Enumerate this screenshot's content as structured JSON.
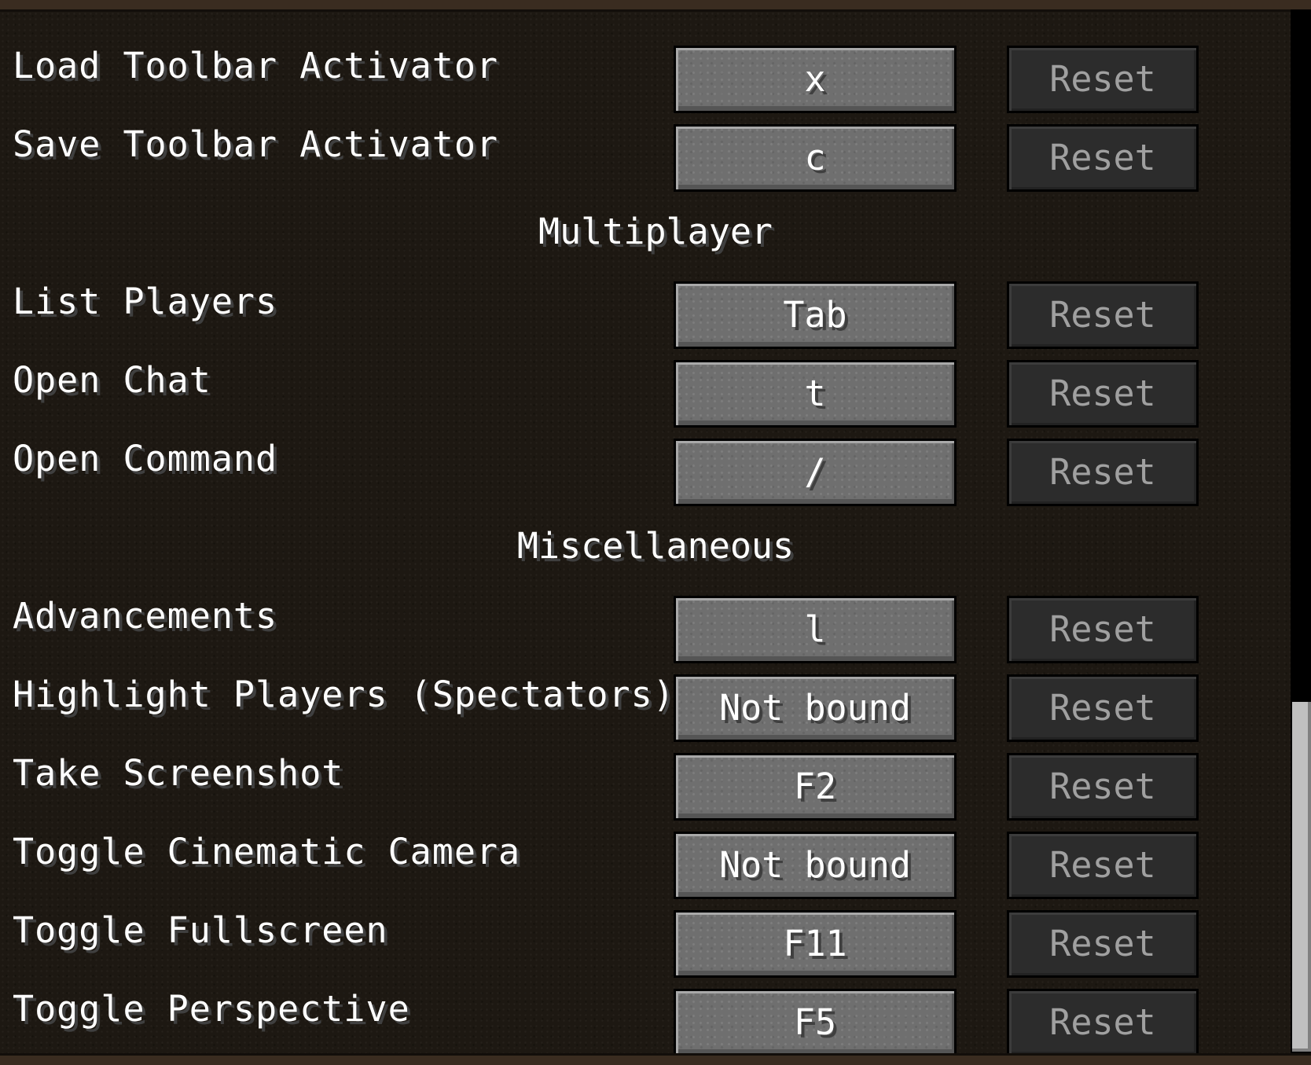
{
  "rows_top": [
    {
      "label": "Load Toolbar Activator",
      "key": "x",
      "reset": "Reset"
    },
    {
      "label": "Save Toolbar Activator",
      "key": "c",
      "reset": "Reset"
    }
  ],
  "multiplayer": {
    "heading": "Multiplayer",
    "rows": [
      {
        "label": "List Players",
        "key": "Tab",
        "reset": "Reset"
      },
      {
        "label": "Open Chat",
        "key": "t",
        "reset": "Reset"
      },
      {
        "label": "Open Command",
        "key": "/",
        "reset": "Reset"
      }
    ]
  },
  "miscellaneous": {
    "heading": "Miscellaneous",
    "rows": [
      {
        "label": "Advancements",
        "key": "l",
        "reset": "Reset"
      },
      {
        "label": "Highlight Players (Spectators)",
        "key": "Not bound",
        "reset": "Reset"
      },
      {
        "label": "Take Screenshot",
        "key": "F2",
        "reset": "Reset"
      },
      {
        "label": "Toggle Cinematic Camera",
        "key": "Not bound",
        "reset": "Reset"
      },
      {
        "label": "Toggle Fullscreen",
        "key": "F11",
        "reset": "Reset"
      },
      {
        "label": "Toggle Perspective",
        "key": "F5",
        "reset": "Reset"
      }
    ]
  }
}
